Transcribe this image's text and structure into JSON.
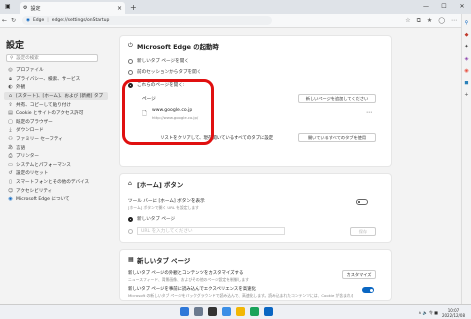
{
  "browser": {
    "tab_title": "設定",
    "tab_close": "×",
    "new_tab": "+",
    "window_buttons": [
      "—",
      "☐",
      "✕"
    ],
    "url_prefix": "Edge",
    "url": "edge://settings/onStartup"
  },
  "sidebar": {
    "title": "設定",
    "search_placeholder": "設定の検索",
    "items": [
      {
        "label": "プロファイル",
        "icon": "profile-icon"
      },
      {
        "label": "プライバシー、検索、サービス",
        "icon": "lock-icon"
      },
      {
        "label": "外観",
        "icon": "appearance-icon"
      },
      {
        "label": "[スタート]、[ホーム]、および [新規] タブ",
        "icon": "home-icon",
        "active": true
      },
      {
        "label": "共有、コピーして貼り付け",
        "icon": "share-icon"
      },
      {
        "label": "Cookie とサイトのアクセス許可",
        "icon": "cookie-icon"
      },
      {
        "label": "既定のブラウザー",
        "icon": "browser-icon"
      },
      {
        "label": "ダウンロード",
        "icon": "download-icon"
      },
      {
        "label": "ファミリー セーフティ",
        "icon": "family-icon"
      },
      {
        "label": "言語",
        "icon": "language-icon"
      },
      {
        "label": "プリンター",
        "icon": "printer-icon"
      },
      {
        "label": "システムとパフォーマンス",
        "icon": "system-icon"
      },
      {
        "label": "設定のリセット",
        "icon": "reset-icon"
      },
      {
        "label": "スマートフォンとその他のデバイス",
        "icon": "phone-icon"
      },
      {
        "label": "アクセシビリティ",
        "icon": "accessibility-icon"
      },
      {
        "label": "Microsoft Edge について",
        "icon": "edge-icon"
      }
    ]
  },
  "startup": {
    "heading": "Microsoft Edge の起動時",
    "options": [
      "新しいタブ ページを開く",
      "前のセッションからタブを開く",
      "これらのページを開く:"
    ],
    "pages_label": "ページ",
    "add_button": "新しいページを追加してください",
    "site_name": "www.google.co.jp",
    "site_url": "http://www.google.co.jp/",
    "more": "⋯",
    "replace_text": "リストをクリアして、現在開いているすべてのタブに設定",
    "replace_button": "開いているすべてのタブを使用"
  },
  "home": {
    "heading": "[ホーム] ボタン",
    "toolbar_label": "ツール バーに [ホーム] ボタンを表示",
    "toolbar_sub": "[ホーム] ボタンで開く URL を設定します",
    "option1": "新しいタブ ページ",
    "option2": "URL を入力してください",
    "save": "保存"
  },
  "newtab": {
    "heading": "新しいタブ ページ",
    "row1_title": "新しいタブ ページの外観とコンテンツをカスタマイズする",
    "row1_sub": "ニュースフィード、背景画像、およびその他のページ設定を制御します",
    "row1_button": "カスタマイズ",
    "row2_title": "新しいタブ ページを事前に読み込んでエクスペリエンスを高速化",
    "row2_sub": "Microsoft の新しいタブ ページをバックグラウンドで読み込んで、高速化します。読み込まれたコンテンツには、Cookie が含まれる場合があります"
  },
  "taskbar": {
    "tray_text": "∧ 🔈 令 ■",
    "time": "10:07",
    "date": "2022/12/08"
  },
  "colors": {
    "highlight": "#e01010",
    "toggle_on": "#0a66c2"
  }
}
